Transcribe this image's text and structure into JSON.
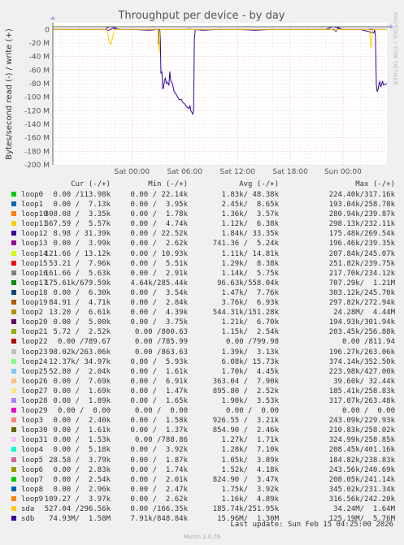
{
  "chart_data": {
    "type": "line",
    "title": "Throughput per device - by day",
    "ylabel": "Bytes/second read (-) / write (+)",
    "ylim": [
      -200,
      10
    ],
    "y_unit": "M",
    "y_ticks": [
      "0",
      "-20 M",
      "-40 M",
      "-60 M",
      "-80 M",
      "-100 M",
      "-120 M",
      "-140 M",
      "-160 M",
      "-180 M",
      "-200 M"
    ],
    "y_tick_values": [
      0,
      -20,
      -40,
      -60,
      -80,
      -100,
      -120,
      -140,
      -160,
      -180,
      -200
    ],
    "x_ticks": [
      "Sat 00:00",
      "Sat 06:00",
      "Sat 12:00",
      "Sat 18:00",
      "Sun 00:00"
    ],
    "x_range_hours": [
      -9,
      29
    ],
    "x_tick_hours": [
      0,
      6,
      12,
      18,
      24
    ],
    "grid": true,
    "series": [
      {
        "name": "sdb",
        "color": "#330099",
        "points": [
          [
            -9,
            0
          ],
          [
            -3,
            0
          ],
          [
            -2.7,
            -1.5
          ],
          [
            -2.2,
            1.5
          ],
          [
            -1,
            0
          ],
          [
            0,
            0
          ],
          [
            2,
            -1
          ],
          [
            3,
            0
          ],
          [
            3,
            -22
          ],
          [
            3.1,
            0
          ],
          [
            3.2,
            -1
          ],
          [
            3.3,
            -65
          ],
          [
            3.4,
            -62
          ],
          [
            3.5,
            -88
          ],
          [
            3.6,
            -85
          ],
          [
            3.7,
            -75
          ],
          [
            3.8,
            -72
          ],
          [
            3.9,
            -79
          ],
          [
            4,
            -78
          ],
          [
            4.2,
            -82
          ],
          [
            4.3,
            -62
          ],
          [
            4.4,
            -75
          ],
          [
            4.5,
            -78
          ],
          [
            4.6,
            -80
          ],
          [
            4.7,
            -86
          ],
          [
            4.8,
            -92
          ],
          [
            5,
            -95
          ],
          [
            5.2,
            -100
          ],
          [
            5.4,
            -104
          ],
          [
            5.6,
            -103
          ],
          [
            5.8,
            -108
          ],
          [
            6,
            -110
          ],
          [
            6.1,
            -112
          ],
          [
            6.3,
            -115
          ],
          [
            6.5,
            -117
          ],
          [
            6.6,
            -112
          ],
          [
            6.7,
            -120
          ],
          [
            6.8,
            -122
          ],
          [
            6.9,
            -125
          ],
          [
            7,
            -120
          ],
          [
            7.05,
            -70
          ],
          [
            7.1,
            -15
          ],
          [
            7.2,
            0
          ],
          [
            8,
            -1
          ],
          [
            10,
            0
          ],
          [
            12,
            0
          ],
          [
            14,
            -1
          ],
          [
            16,
            0
          ],
          [
            18,
            0
          ],
          [
            20,
            0
          ],
          [
            22,
            0
          ],
          [
            23,
            0
          ],
          [
            23.2,
            -3
          ],
          [
            23.4,
            2
          ],
          [
            24,
            0
          ],
          [
            26,
            0
          ],
          [
            27.5,
            -5
          ],
          [
            27.6,
            0
          ],
          [
            27.7,
            -12
          ],
          [
            27.8,
            -82
          ],
          [
            27.9,
            -92
          ],
          [
            28,
            -88
          ],
          [
            28.1,
            -80
          ],
          [
            28.2,
            -77
          ],
          [
            28.3,
            -85
          ],
          [
            28.4,
            -81
          ],
          [
            28.5,
            -76
          ],
          [
            28.6,
            -82
          ],
          [
            29,
            -80
          ]
        ]
      },
      {
        "name": "sdb_write",
        "color": "#330099",
        "points": [
          [
            -9,
            0
          ],
          [
            -3,
            0
          ],
          [
            -2.7,
            3.5
          ],
          [
            -2.4,
            4
          ],
          [
            -2,
            3
          ],
          [
            -1.5,
            0
          ],
          [
            6,
            0
          ],
          [
            6.5,
            0.8
          ],
          [
            7,
            0
          ],
          [
            22,
            0
          ],
          [
            22.8,
            4
          ],
          [
            23.4,
            3
          ],
          [
            24,
            0
          ],
          [
            26,
            0
          ],
          [
            27,
            0.5
          ],
          [
            29,
            0
          ]
        ]
      },
      {
        "name": "sda",
        "color": "#ffcc00",
        "points": [
          [
            -9,
            0
          ],
          [
            -2.8,
            0
          ],
          [
            -2.6,
            -18
          ],
          [
            -2.4,
            -22
          ],
          [
            -2.2,
            -12
          ],
          [
            -2,
            0
          ],
          [
            3,
            0
          ],
          [
            3.1,
            -35
          ],
          [
            3.2,
            0
          ],
          [
            22.8,
            0
          ],
          [
            22.9,
            -1
          ],
          [
            23.2,
            -1
          ],
          [
            23.4,
            0
          ],
          [
            27,
            0
          ],
          [
            27.2,
            -28
          ],
          [
            27.4,
            0
          ],
          [
            29,
            0
          ]
        ]
      }
    ]
  },
  "watermark": "RRDTOOL / TOBI OETIKER",
  "legend": {
    "headers": {
      "cur": "Cur (-/+)",
      "min": "Min (-/+)",
      "avg": "Avg (-/+)",
      "max": "Max (-/+)"
    },
    "rows": [
      {
        "name": "loop0",
        "color": "#00cc00",
        "cur": "0.00 /113.98k",
        "min": "0.00 / 22.14k",
        "avg": "1.83k/ 48.38k",
        "max": "224.40k/317.16k"
      },
      {
        "name": "loop1",
        "color": "#0066b3",
        "cur": "0.00 /  7.13k",
        "min": "0.00 /  3.95k",
        "avg": "2.45k/  8.65k",
        "max": "193.04k/258.78k"
      },
      {
        "name": "loop10",
        "color": "#ff8000",
        "cur": "308.08 /  3.35k",
        "min": "0.00 /  1.78k",
        "avg": "1.36k/  3.57k",
        "max": "280.94k/239.87k"
      },
      {
        "name": "loop11",
        "color": "#ffcc00",
        "cur": "567.59 /  5.57k",
        "min": "0.00 /  4.74k",
        "avg": "1.12k/  6.38k",
        "max": "298.13k/232.11k"
      },
      {
        "name": "loop12",
        "color": "#330099",
        "cur": "8.98 / 31.39k",
        "min": "0.00 / 22.52k",
        "avg": "1.84k/ 33.35k",
        "max": "175.48k/269.54k"
      },
      {
        "name": "loop13",
        "color": "#990099",
        "cur": "0.00 /  3.99k",
        "min": "0.00 /  2.62k",
        "avg": "741.36 /  5.24k",
        "max": "196.46k/239.35k"
      },
      {
        "name": "loop14",
        "color": "#ccff00",
        "cur": "121.66 / 13.12k",
        "min": "0.00 / 10.93k",
        "avg": "1.11k/ 14.81k",
        "max": "207.84k/245.07k"
      },
      {
        "name": "loop15",
        "color": "#ff0000",
        "cur": "53.21 /  7.96k",
        "min": "0.00 /  5.51k",
        "avg": "1.29k/  8.38k",
        "max": "251.82k/239.75k"
      },
      {
        "name": "loop16",
        "color": "#808080",
        "cur": "161.66 /  5.63k",
        "min": "0.00 /  2.91k",
        "avg": "1.14k/  5.75k",
        "max": "217.70k/234.12k"
      },
      {
        "name": "loop17",
        "color": "#008f00",
        "cur": "175.61k/679.59k",
        "min": "4.64k/285.44k",
        "avg": "96.63k/558.04k",
        "max": "707.29k/  1.21M"
      },
      {
        "name": "loop18",
        "color": "#00487d",
        "cur": "0.00 /  6.30k",
        "min": "0.00 /  3.54k",
        "avg": "1.47k/  7.76k",
        "max": "303.12k/245.70k"
      },
      {
        "name": "loop19",
        "color": "#b35a00",
        "cur": "84.91 /  4.71k",
        "min": "0.00 /  2.84k",
        "avg": "3.76k/  6.93k",
        "max": "297.82k/272.94k"
      },
      {
        "name": "loop2",
        "color": "#b38f00",
        "cur": "13.20 /  6.61k",
        "min": "0.00 /  4.39k",
        "avg": "544.31k/151.28k",
        "max": "24.28M/  4.44M"
      },
      {
        "name": "loop20",
        "color": "#6b006b",
        "cur": "0.00 /  5.00k",
        "min": "0.00 /  3.75k",
        "avg": "1.21k/  6.70k",
        "max": "194.93k/301.94k"
      },
      {
        "name": "loop21",
        "color": "#8fb300",
        "cur": "5.72 /  2.52k",
        "min": "0.00 /800.63",
        "avg": "1.15k/  2.54k",
        "max": "203.45k/256.88k"
      },
      {
        "name": "loop22",
        "color": "#b30000",
        "cur": "0.00 /789.67",
        "min": "0.00 /785.99",
        "avg": "0.00 /799.98",
        "max": "0.00 /811.94"
      },
      {
        "name": "loop23",
        "color": "#bebebe",
        "cur": "98.02k/263.06k",
        "min": "0.00 /863.63",
        "avg": "1.39k/  3.13k",
        "max": "196.27k/263.06k"
      },
      {
        "name": "loop24",
        "color": "#80ff80",
        "cur": "12.37k/ 34.97k",
        "min": "0.00 /  5.93k",
        "avg": "6.08k/ 15.73k",
        "max": "374.14k/352.50k"
      },
      {
        "name": "loop25",
        "color": "#80c9ff",
        "cur": "52.80 /  2.04k",
        "min": "0.00 /  1.61k",
        "avg": "1.70k/  4.45k",
        "max": "223.98k/427.00k"
      },
      {
        "name": "loop26",
        "color": "#ffc080",
        "cur": "0.00 /  7.69k",
        "min": "0.00 /  6.91k",
        "avg": "363.04 /  7.90k",
        "max": "39.60k/ 32.44k"
      },
      {
        "name": "loop27",
        "color": "#ffe680",
        "cur": "0.00 /  1.69k",
        "min": "0.00 /  1.47k",
        "avg": "895.80 /  2.52k",
        "max": "185.41k/258.83k"
      },
      {
        "name": "loop28",
        "color": "#aa80ff",
        "cur": "0.00 /  1.89k",
        "min": "0.00 /  1.65k",
        "avg": "1.90k/  3.53k",
        "max": "317.07k/263.48k"
      },
      {
        "name": "loop29",
        "color": "#ee00cc",
        "cur": "0.00 /  0.00",
        "min": "0.00 /  0.00",
        "avg": "0.00 /  0.00",
        "max": "0.00 /  0.00"
      },
      {
        "name": "loop3",
        "color": "#ff8080",
        "cur": "0.00 /  2.40k",
        "min": "0.00 /  1.58k",
        "avg": "926.55 /  3.21k",
        "max": "243.09k/229.93k"
      },
      {
        "name": "loop30",
        "color": "#666600",
        "cur": "0.00 /  1.61k",
        "min": "0.00 /  1.37k",
        "avg": "854.90 /  2.46k",
        "max": "210.83k/258.02k"
      },
      {
        "name": "loop31",
        "color": "#ffbfff",
        "cur": "0.00 /  1.53k",
        "min": "0.00 /788.86",
        "avg": "1.27k/  1.71k",
        "max": "324.99k/258.85k"
      },
      {
        "name": "loop4",
        "color": "#00ffcc",
        "cur": "0.00 /  5.18k",
        "min": "0.00 /  3.92k",
        "avg": "1.28k/  7.10k",
        "max": "208.45k/401.16k"
      },
      {
        "name": "loop5",
        "color": "#cc6699",
        "cur": "28.58 /  3.79k",
        "min": "0.00 /  1.87k",
        "avg": "1.05k/  3.89k",
        "max": "184.82k/238.83k"
      },
      {
        "name": "loop6",
        "color": "#999900",
        "cur": "0.00 /  2.83k",
        "min": "0.00 /  1.74k",
        "avg": "1.52k/  4.18k",
        "max": "243.56k/240.69k"
      },
      {
        "name": "loop7",
        "color": "#00cc00",
        "cur": "0.00 /  2.54k",
        "min": "0.00 /  2.01k",
        "avg": "824.90 /  3.47k",
        "max": "208.05k/241.14k"
      },
      {
        "name": "loop8",
        "color": "#0066b3",
        "cur": "0.00 /  2.96k",
        "min": "0.00 /  2.47k",
        "avg": "1.75k/  3.92k",
        "max": "345.02k/231.34k"
      },
      {
        "name": "loop9",
        "color": "#ff8000",
        "cur": "109.27 /  3.97k",
        "min": "0.00 /  2.62k",
        "avg": "1.16k/  4.89k",
        "max": "316.56k/242.20k"
      },
      {
        "name": "sda",
        "color": "#ffcc00",
        "cur": "527.04 /296.56k",
        "min": "0.00 /166.35k",
        "avg": "185.74k/251.95k",
        "max": "34.24M/  1.64M"
      },
      {
        "name": "sdb",
        "color": "#330099",
        "cur": "74.93M/  1.58M",
        "min": "7.91k/848.84k",
        "avg": "15.96M/  1.30M",
        "max": "125.19M/  5.76M"
      }
    ]
  },
  "footer": {
    "last_update": "Last update: Sun Feb 15 04:25:00 2026",
    "munin": "Munin 2.0.76"
  }
}
